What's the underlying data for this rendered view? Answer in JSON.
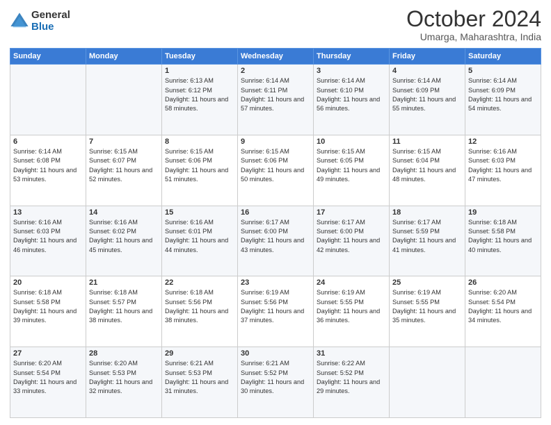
{
  "logo": {
    "general": "General",
    "blue": "Blue"
  },
  "header": {
    "month": "October 2024",
    "location": "Umarga, Maharashtra, India"
  },
  "weekdays": [
    "Sunday",
    "Monday",
    "Tuesday",
    "Wednesday",
    "Thursday",
    "Friday",
    "Saturday"
  ],
  "weeks": [
    [
      {
        "day": "",
        "info": ""
      },
      {
        "day": "",
        "info": ""
      },
      {
        "day": "1",
        "info": "Sunrise: 6:13 AM\nSunset: 6:12 PM\nDaylight: 11 hours and 58 minutes."
      },
      {
        "day": "2",
        "info": "Sunrise: 6:14 AM\nSunset: 6:11 PM\nDaylight: 11 hours and 57 minutes."
      },
      {
        "day": "3",
        "info": "Sunrise: 6:14 AM\nSunset: 6:10 PM\nDaylight: 11 hours and 56 minutes."
      },
      {
        "day": "4",
        "info": "Sunrise: 6:14 AM\nSunset: 6:09 PM\nDaylight: 11 hours and 55 minutes."
      },
      {
        "day": "5",
        "info": "Sunrise: 6:14 AM\nSunset: 6:09 PM\nDaylight: 11 hours and 54 minutes."
      }
    ],
    [
      {
        "day": "6",
        "info": "Sunrise: 6:14 AM\nSunset: 6:08 PM\nDaylight: 11 hours and 53 minutes."
      },
      {
        "day": "7",
        "info": "Sunrise: 6:15 AM\nSunset: 6:07 PM\nDaylight: 11 hours and 52 minutes."
      },
      {
        "day": "8",
        "info": "Sunrise: 6:15 AM\nSunset: 6:06 PM\nDaylight: 11 hours and 51 minutes."
      },
      {
        "day": "9",
        "info": "Sunrise: 6:15 AM\nSunset: 6:06 PM\nDaylight: 11 hours and 50 minutes."
      },
      {
        "day": "10",
        "info": "Sunrise: 6:15 AM\nSunset: 6:05 PM\nDaylight: 11 hours and 49 minutes."
      },
      {
        "day": "11",
        "info": "Sunrise: 6:15 AM\nSunset: 6:04 PM\nDaylight: 11 hours and 48 minutes."
      },
      {
        "day": "12",
        "info": "Sunrise: 6:16 AM\nSunset: 6:03 PM\nDaylight: 11 hours and 47 minutes."
      }
    ],
    [
      {
        "day": "13",
        "info": "Sunrise: 6:16 AM\nSunset: 6:03 PM\nDaylight: 11 hours and 46 minutes."
      },
      {
        "day": "14",
        "info": "Sunrise: 6:16 AM\nSunset: 6:02 PM\nDaylight: 11 hours and 45 minutes."
      },
      {
        "day": "15",
        "info": "Sunrise: 6:16 AM\nSunset: 6:01 PM\nDaylight: 11 hours and 44 minutes."
      },
      {
        "day": "16",
        "info": "Sunrise: 6:17 AM\nSunset: 6:00 PM\nDaylight: 11 hours and 43 minutes."
      },
      {
        "day": "17",
        "info": "Sunrise: 6:17 AM\nSunset: 6:00 PM\nDaylight: 11 hours and 42 minutes."
      },
      {
        "day": "18",
        "info": "Sunrise: 6:17 AM\nSunset: 5:59 PM\nDaylight: 11 hours and 41 minutes."
      },
      {
        "day": "19",
        "info": "Sunrise: 6:18 AM\nSunset: 5:58 PM\nDaylight: 11 hours and 40 minutes."
      }
    ],
    [
      {
        "day": "20",
        "info": "Sunrise: 6:18 AM\nSunset: 5:58 PM\nDaylight: 11 hours and 39 minutes."
      },
      {
        "day": "21",
        "info": "Sunrise: 6:18 AM\nSunset: 5:57 PM\nDaylight: 11 hours and 38 minutes."
      },
      {
        "day": "22",
        "info": "Sunrise: 6:18 AM\nSunset: 5:56 PM\nDaylight: 11 hours and 38 minutes."
      },
      {
        "day": "23",
        "info": "Sunrise: 6:19 AM\nSunset: 5:56 PM\nDaylight: 11 hours and 37 minutes."
      },
      {
        "day": "24",
        "info": "Sunrise: 6:19 AM\nSunset: 5:55 PM\nDaylight: 11 hours and 36 minutes."
      },
      {
        "day": "25",
        "info": "Sunrise: 6:19 AM\nSunset: 5:55 PM\nDaylight: 11 hours and 35 minutes."
      },
      {
        "day": "26",
        "info": "Sunrise: 6:20 AM\nSunset: 5:54 PM\nDaylight: 11 hours and 34 minutes."
      }
    ],
    [
      {
        "day": "27",
        "info": "Sunrise: 6:20 AM\nSunset: 5:54 PM\nDaylight: 11 hours and 33 minutes."
      },
      {
        "day": "28",
        "info": "Sunrise: 6:20 AM\nSunset: 5:53 PM\nDaylight: 11 hours and 32 minutes."
      },
      {
        "day": "29",
        "info": "Sunrise: 6:21 AM\nSunset: 5:53 PM\nDaylight: 11 hours and 31 minutes."
      },
      {
        "day": "30",
        "info": "Sunrise: 6:21 AM\nSunset: 5:52 PM\nDaylight: 11 hours and 30 minutes."
      },
      {
        "day": "31",
        "info": "Sunrise: 6:22 AM\nSunset: 5:52 PM\nDaylight: 11 hours and 29 minutes."
      },
      {
        "day": "",
        "info": ""
      },
      {
        "day": "",
        "info": ""
      }
    ]
  ]
}
